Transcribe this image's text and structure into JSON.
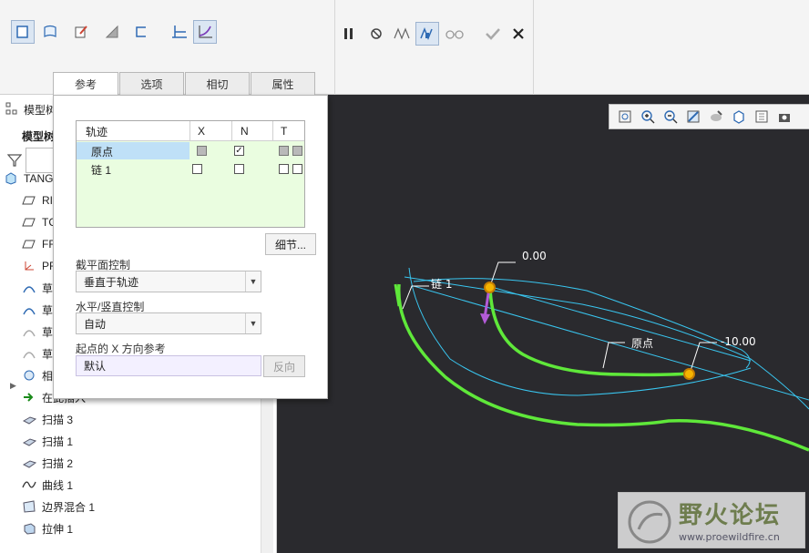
{
  "ribbon": {
    "left_tools": [
      "surface-icon",
      "thin-icon",
      "edit-sketch-icon",
      "remove-material-icon",
      "open-section-icon",
      "constant-section-icon",
      "variable-section-icon"
    ],
    "right_tools": [
      "pause-icon",
      "no-preview-icon",
      "preview-geometry-icon",
      "verify-icon",
      "glasses-icon",
      "confirm-icon",
      "cancel-icon"
    ]
  },
  "tabs": [
    {
      "label": "参考",
      "active": true
    },
    {
      "label": "选项",
      "active": false
    },
    {
      "label": "相切",
      "active": false
    },
    {
      "label": "属性",
      "active": false
    }
  ],
  "panel": {
    "table": {
      "headers": [
        "轨迹",
        "X",
        "N",
        "T"
      ],
      "rows": [
        {
          "name": "原点",
          "x": "gray",
          "n": "checked",
          "t": [
            "gray",
            "gray"
          ],
          "selected": true
        },
        {
          "name": "链 1",
          "x": "empty",
          "n": "empty",
          "t": [
            "empty",
            "empty"
          ],
          "selected": false
        }
      ]
    },
    "details_button": "细节...",
    "section_plane_label": "截平面控制",
    "section_plane_value": "垂直于轨迹",
    "hv_control_label": "水平/竖直控制",
    "hv_control_value": "自动",
    "x_ref_label": "起点的 X 方向参考",
    "x_ref_value": "默认",
    "flip_button": "反向"
  },
  "tree": {
    "header_label": "模型树",
    "sub_label": "模型树",
    "items": [
      {
        "label": "TANG",
        "icon": "part-icon"
      },
      {
        "label": "RI",
        "icon": "plane-icon"
      },
      {
        "label": "TC",
        "icon": "plane-icon"
      },
      {
        "label": "FF",
        "icon": "plane-icon"
      },
      {
        "label": "PF",
        "icon": "csys-icon"
      },
      {
        "label": "草",
        "icon": "sketch-icon"
      },
      {
        "label": "草",
        "icon": "sketch-icon"
      },
      {
        "label": "草",
        "icon": "sketch-faded-icon"
      },
      {
        "label": "草",
        "icon": "sketch-faded-icon"
      },
      {
        "label": "相",
        "icon": "group-icon"
      },
      {
        "label": "在此插入",
        "icon": "insert-arrow-icon"
      },
      {
        "label": "扫描 3",
        "icon": "sweep-icon"
      },
      {
        "label": "扫描 1",
        "icon": "sweep-icon"
      },
      {
        "label": "扫描 2",
        "icon": "sweep-icon"
      },
      {
        "label": "曲线 1",
        "icon": "curve-icon"
      },
      {
        "label": "边界混合 1",
        "icon": "boundary-blend-icon"
      },
      {
        "label": "拉伸 1",
        "icon": "extrude-icon"
      }
    ]
  },
  "viewport": {
    "labels": {
      "dim_zero": "0.00",
      "chain": "链 1",
      "origin": "原点",
      "dim_neg": "-10.00"
    },
    "toolbar": [
      "zoom-fit-icon",
      "zoom-in-icon",
      "zoom-out-icon",
      "repaint-icon",
      "orient-icon",
      "saved-views-icon",
      "display-style-icon",
      "view-manager-icon"
    ]
  },
  "watermark": {
    "title": "野火论坛",
    "url": "www.proewildfire.cn"
  },
  "colors": {
    "selection": "#bfe0f7",
    "table_bg": "#eafde0",
    "curve_green": "#5fe83a",
    "curve_blue": "#39c6f0",
    "point_orange": "#f5b400"
  }
}
